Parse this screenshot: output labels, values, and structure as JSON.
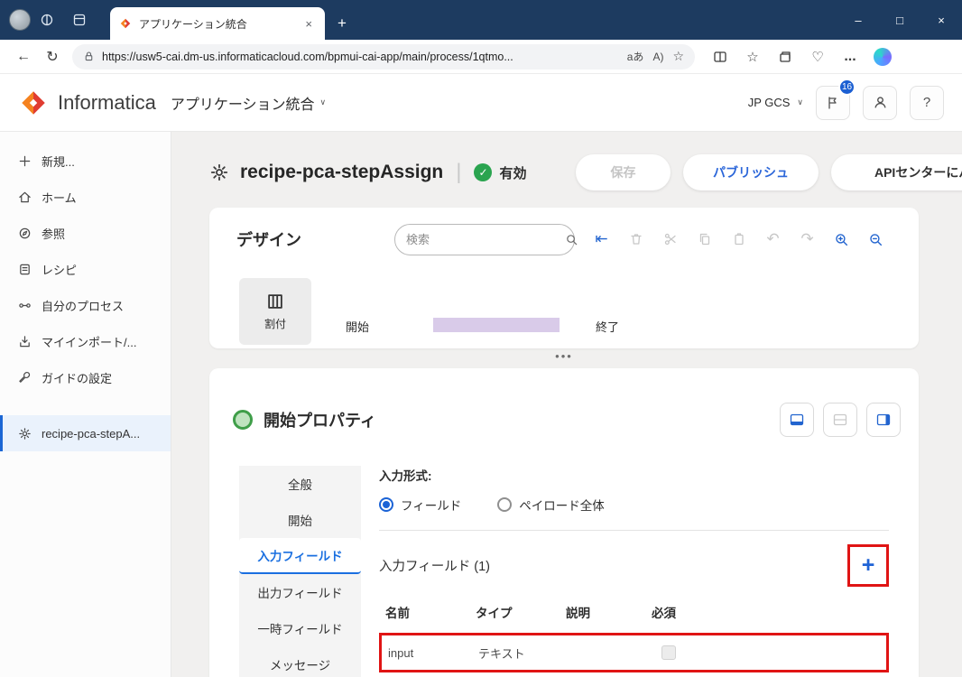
{
  "browser": {
    "tab_title": "アプリケーション統合",
    "url": "https://usw5-cai.dm-us.informaticacloud.com/bpmui-cai-app/main/process/1qtmo..."
  },
  "header": {
    "brand": "Informatica",
    "app_title": "アプリケーション統合",
    "user": "JP GCS",
    "notification_count": "16",
    "help": "?"
  },
  "sidebar": {
    "items": [
      {
        "label": "新規..."
      },
      {
        "label": "ホーム"
      },
      {
        "label": "参照"
      },
      {
        "label": "レシピ"
      },
      {
        "label": "自分のプロセス"
      },
      {
        "label": "マイインポート/..."
      },
      {
        "label": "ガイドの設定"
      },
      {
        "label": "recipe-pca-stepA..."
      }
    ]
  },
  "process": {
    "title": "recipe-pca-stepAssign",
    "status": "有効",
    "save_label": "保存",
    "publish_label": "パブリッシュ",
    "api_label": "APIセンターにパ..."
  },
  "design": {
    "title": "デザイン",
    "search_placeholder": "検索",
    "node_assign": "割付",
    "node_start": "開始",
    "node_end": "終了"
  },
  "props": {
    "title": "開始プロパティ",
    "tabs": [
      {
        "label": "全般"
      },
      {
        "label": "開始"
      },
      {
        "label": "入力フィールド"
      },
      {
        "label": "出力フィールド"
      },
      {
        "label": "一時フィールド"
      },
      {
        "label": "メッセージ"
      }
    ],
    "input_format_label": "入力形式:",
    "radio_field": "フィールド",
    "radio_payload": "ペイロード全体",
    "fields_count_label": "入力フィールド (1)",
    "table": {
      "headers": [
        "名前",
        "タイプ",
        "説明",
        "必須"
      ],
      "row": {
        "name": "input",
        "type": "テキスト",
        "description": ""
      }
    }
  },
  "icons": {
    "minimize": "–",
    "maximize": "□",
    "close": "×",
    "new_tab": "+",
    "tab_close": "×",
    "back": "←",
    "refresh": "↻",
    "translate": "aあ",
    "read_aloud": "A)",
    "star": "☆",
    "fav_star": "☆",
    "heart": "♡",
    "menu_ellipsis": "...",
    "chevron_down": "∨",
    "pipe": "|",
    "check": "✓",
    "drag_dots": "•••",
    "undo": "↶",
    "redo": "↷",
    "collapse": "⇤",
    "plus": "+"
  }
}
